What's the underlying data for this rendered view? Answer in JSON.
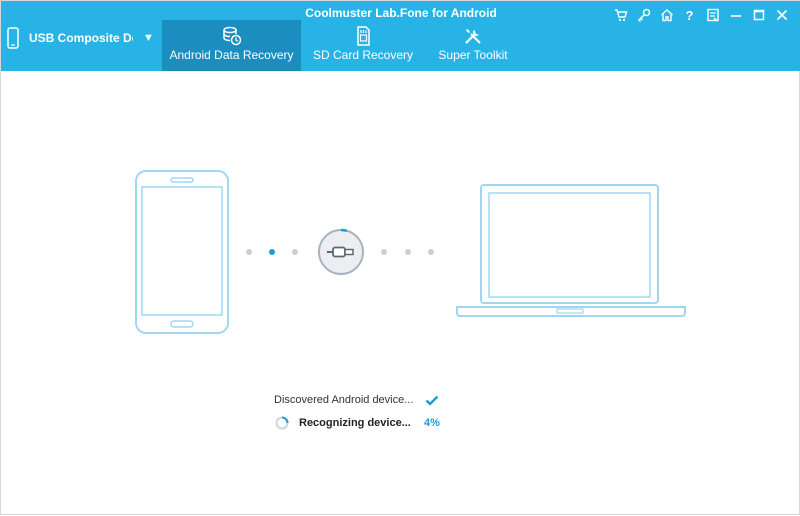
{
  "app": {
    "title": "Coolmuster Lab.Fone for Android"
  },
  "device": {
    "name": "USB  Composite Devi",
    "icon": "phone-icon",
    "dropdown_icon": "dropdown-arrow-icon"
  },
  "tabs": [
    {
      "label": "Android Data Recovery",
      "icon": "database-restore-icon",
      "active": true
    },
    {
      "label": "SD Card Recovery",
      "icon": "sd-card-icon",
      "active": false
    },
    {
      "label": "Super Toolkit",
      "icon": "tools-icon",
      "active": false
    }
  ],
  "controls": [
    "cart-icon",
    "key-icon",
    "home-icon",
    "help-icon",
    "feedback-icon",
    "minimize-icon",
    "maximize-icon",
    "close-icon"
  ],
  "status": {
    "discovered": "Discovered Android device...",
    "recognizing": "Recognizing device...",
    "progress": "4%"
  },
  "colors": {
    "header": "#27b3e6",
    "active_tab": "#1b8dbe",
    "illustration": "#9fd7f1",
    "accent": "#1f9bd7"
  }
}
